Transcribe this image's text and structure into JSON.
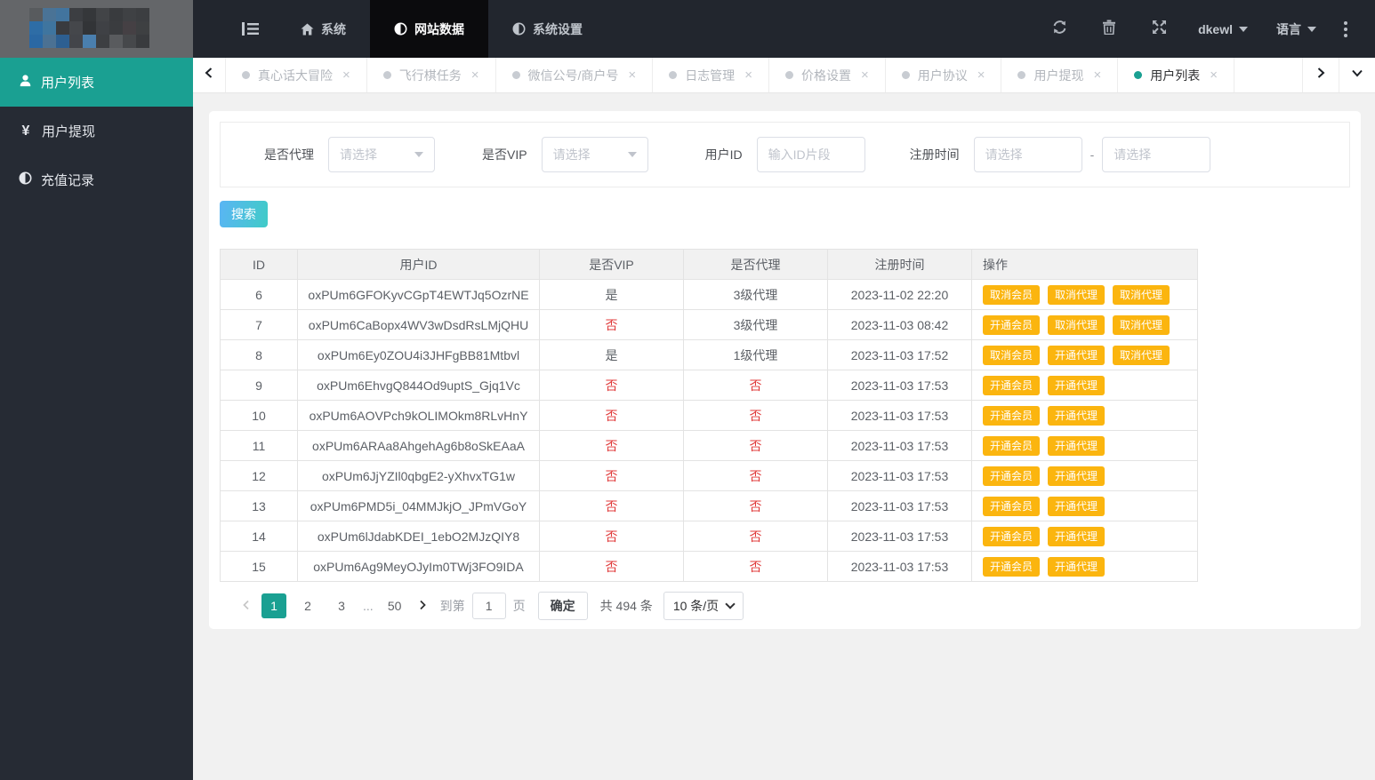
{
  "navbar": {
    "menu": [
      {
        "label": "系统",
        "icon": "home",
        "active": false
      },
      {
        "label": "网站数据",
        "icon": "half-circle",
        "active": true
      },
      {
        "label": "系统设置",
        "icon": "half-circle",
        "active": false
      }
    ],
    "username": "dkewl",
    "language_label": "语言"
  },
  "logo": {
    "pixel_rows": [
      [
        "#585b5e",
        "#4a7396",
        "#42749e",
        "#3c3e42",
        "#35373a",
        "#424447",
        "#393b3e",
        "#3f4144",
        "#3c3e41"
      ],
      [
        "#2e6da6",
        "#3f759f",
        "#393b3f",
        "#45474b",
        "#323437",
        "#3f4145",
        "#3a3c3f",
        "#454044",
        "#3e4042"
      ],
      [
        "#2a68a4",
        "#4b7193",
        "#2d5f91",
        "#43454a",
        "#4a7fae",
        "#3d3f42",
        "#595b5e",
        "#46484b",
        "#393b3e"
      ]
    ]
  },
  "sidebar": {
    "items": [
      {
        "name": "user-list",
        "label": "用户列表",
        "icon": "user",
        "active": true
      },
      {
        "name": "user-withdraw",
        "label": "用户提现",
        "icon": "yen",
        "active": false
      },
      {
        "name": "recharge-records",
        "label": "充值记录",
        "icon": "half-circle",
        "active": false
      }
    ]
  },
  "tabs": [
    {
      "name": "truth-or-dare",
      "label": "真心话大冒险",
      "active": false
    },
    {
      "name": "flight-chess-task",
      "label": "飞行棋任务",
      "active": false
    },
    {
      "name": "wechat-official-merchant",
      "label": "微信公号/商户号",
      "active": false
    },
    {
      "name": "log-management",
      "label": "日志管理",
      "active": false
    },
    {
      "name": "price-settings",
      "label": "价格设置",
      "active": false
    },
    {
      "name": "user-agreement",
      "label": "用户协议",
      "active": false
    },
    {
      "name": "user-withdraw",
      "label": "用户提现",
      "active": false
    },
    {
      "name": "user-list",
      "label": "用户列表",
      "active": true
    }
  ],
  "filters": {
    "agent_label": "是否代理",
    "agent_value": "请选择",
    "vip_label": "是否VIP",
    "vip_value": "请选择",
    "user_id_label": "用户ID",
    "user_id_placeholder": "输入ID片段",
    "reg_time_label": "注册时间",
    "date_start_placeholder": "请选择",
    "date_end_placeholder": "请选择",
    "range_separator": "-",
    "search_label": "搜索"
  },
  "table": {
    "headers": [
      "ID",
      "用户ID",
      "是否VIP",
      "是否代理",
      "注册时间",
      "操作"
    ],
    "rows": [
      {
        "id": "6",
        "user_id": "oxPUm6GFOKyvCGpT4EWTJq5OzrNE",
        "vip": "是",
        "agent": "3级代理",
        "reg_time": "2023-11-02 22:20",
        "actions": [
          "取消会员",
          "取消代理",
          "取消代理"
        ]
      },
      {
        "id": "7",
        "user_id": "oxPUm6CaBopx4WV3wDsdRsLMjQHU",
        "vip": "否",
        "agent": "3级代理",
        "reg_time": "2023-11-03 08:42",
        "actions": [
          "开通会员",
          "取消代理",
          "取消代理"
        ]
      },
      {
        "id": "8",
        "user_id": "oxPUm6Ey0ZOU4i3JHFgBB81Mtbvl",
        "vip": "是",
        "agent": "1级代理",
        "reg_time": "2023-11-03 17:52",
        "actions": [
          "取消会员",
          "开通代理",
          "取消代理"
        ]
      },
      {
        "id": "9",
        "user_id": "oxPUm6EhvgQ844Od9uptS_Gjq1Vc",
        "vip": "否",
        "agent": "否",
        "reg_time": "2023-11-03 17:53",
        "actions": [
          "开通会员",
          "开通代理"
        ]
      },
      {
        "id": "10",
        "user_id": "oxPUm6AOVPch9kOLIMOkm8RLvHnY",
        "vip": "否",
        "agent": "否",
        "reg_time": "2023-11-03 17:53",
        "actions": [
          "开通会员",
          "开通代理"
        ]
      },
      {
        "id": "11",
        "user_id": "oxPUm6ARAa8AhgehAg6b8oSkEAaA",
        "vip": "否",
        "agent": "否",
        "reg_time": "2023-11-03 17:53",
        "actions": [
          "开通会员",
          "开通代理"
        ]
      },
      {
        "id": "12",
        "user_id": "oxPUm6JjYZIl0qbgE2-yXhvxTG1w",
        "vip": "否",
        "agent": "否",
        "reg_time": "2023-11-03 17:53",
        "actions": [
          "开通会员",
          "开通代理"
        ]
      },
      {
        "id": "13",
        "user_id": "oxPUm6PMD5i_04MMJkjO_JPmVGoY",
        "vip": "否",
        "agent": "否",
        "reg_time": "2023-11-03 17:53",
        "actions": [
          "开通会员",
          "开通代理"
        ]
      },
      {
        "id": "14",
        "user_id": "oxPUm6lJdabKDEI_1ebO2MJzQIY8",
        "vip": "否",
        "agent": "否",
        "reg_time": "2023-11-03 17:53",
        "actions": [
          "开通会员",
          "开通代理"
        ]
      },
      {
        "id": "15",
        "user_id": "oxPUm6Ag9MeyOJyIm0TWj3FO9IDA",
        "vip": "否",
        "agent": "否",
        "reg_time": "2023-11-03 17:53",
        "actions": [
          "开通会员",
          "开通代理"
        ]
      }
    ]
  },
  "pagination": {
    "pages": [
      "1",
      "2",
      "3",
      "...",
      "50"
    ],
    "active_page": "1",
    "goto_label": "到第",
    "goto_value": "1",
    "page_unit_label": "页",
    "confirm_label": "确定",
    "total_label": "共 494 条",
    "page_size_label": "10 条/页"
  },
  "colors": {
    "accent_teal": "#1aa092",
    "navbar_bg": "#22262e",
    "navbar_active_bg": "#0b0b0d",
    "sidebar_bg": "#262b34",
    "action_yellow": "#fbb50f",
    "negative_red": "#e03a3a",
    "search_gradient_start": "#5ab5f4",
    "search_gradient_end": "#40cbc7"
  }
}
